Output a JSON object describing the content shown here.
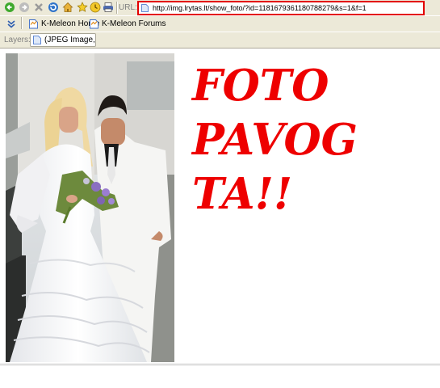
{
  "toolbar": {
    "url_label": "URL:",
    "url_value": "http://img.lrytas.lt/show_foto/?id=1181679361180788279&s=1&f=1",
    "icons": [
      "back-icon",
      "forward-icon",
      "stop-icon",
      "reload-icon",
      "home-icon",
      "bookmark-star-icon",
      "history-icon",
      "print-icon"
    ]
  },
  "bookmarks": {
    "items": [
      {
        "label": "K-Meleon Home"
      },
      {
        "label": "K-Meleon Forums"
      }
    ]
  },
  "layers": {
    "label": "Layers:",
    "tab_label": "(JPEG Image, ..."
  },
  "page": {
    "headline_lines": [
      "FOTO",
      "PAVOG",
      "TA!!"
    ],
    "headline_color": "#ee0000",
    "photo_description": "wedding photo"
  }
}
